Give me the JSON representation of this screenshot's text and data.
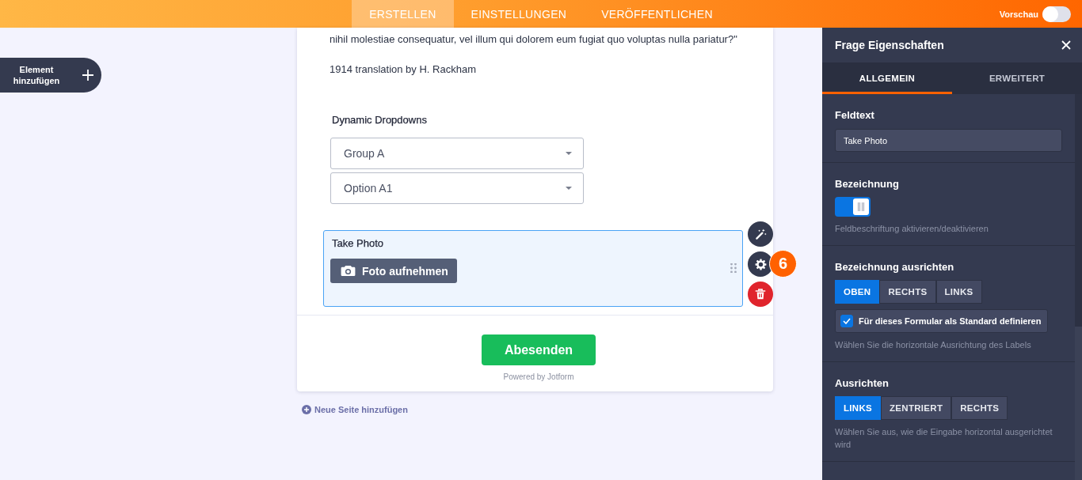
{
  "header": {
    "tabs": [
      {
        "label": "ERSTELLEN",
        "selected": true
      },
      {
        "label": "EINSTELLUNGEN",
        "selected": false
      },
      {
        "label": "VERÖFFENTLICHEN",
        "selected": false
      }
    ],
    "preview": {
      "label": "Vorschau",
      "on": false
    }
  },
  "add_element": {
    "label": "Element hinzufügen"
  },
  "form": {
    "paragraphs": [
      "nihil molestiae consequatur, vel illum qui dolorem eum fugiat quo voluptas nulla pariatur?\"",
      "1914 translation by H. Rackham"
    ],
    "questions": [
      {
        "kind": "dropdowns",
        "label": "Dynamic Dropdowns",
        "selects": [
          "Group A",
          "Option A1"
        ],
        "selected": false
      },
      {
        "kind": "photo",
        "label": "Take Photo",
        "button": "Foto aufnehmen",
        "selected": true,
        "badge": "6"
      }
    ],
    "submit": "Abesenden",
    "powered_by": "Powered by Jotform"
  },
  "add_page": {
    "label": "Neue Seite hinzufügen"
  },
  "properties": {
    "title": "Frage Eigenschaften",
    "tabs": [
      {
        "label": "ALLGEMEIN",
        "selected": true
      },
      {
        "label": "ERWEITERT",
        "selected": false
      }
    ],
    "sections": [
      {
        "kind": "text",
        "label": "Feldtext",
        "value": "Take Photo"
      },
      {
        "kind": "toggle",
        "label": "Bezeichnung",
        "on": true,
        "hint": "Feldbeschriftung aktivieren/deaktivieren"
      },
      {
        "kind": "segmented",
        "label": "Bezeichnung ausrichten",
        "options": [
          {
            "label": "OBEN",
            "selected": true
          },
          {
            "label": "RECHTS",
            "selected": false
          },
          {
            "label": "LINKS",
            "selected": false
          }
        ],
        "checkbox": {
          "label": "Für dieses Formular als Standard definieren",
          "checked": true
        },
        "hint": "Wählen Sie die horizontale Ausrichtung des Labels"
      },
      {
        "kind": "segmented",
        "label": "Ausrichten",
        "options": [
          {
            "label": "LINKS",
            "selected": true
          },
          {
            "label": "ZENTRIERT",
            "selected": false
          },
          {
            "label": "RECHTS",
            "selected": false
          }
        ],
        "hint": "Wählen Sie aus, wie die Eingabe horizontal ausgerichtet wird"
      }
    ]
  }
}
